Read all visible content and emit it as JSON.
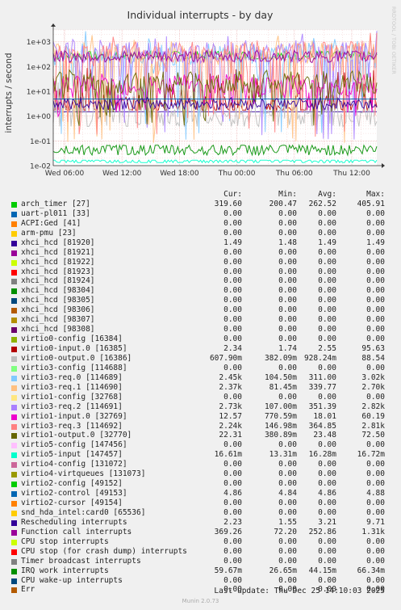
{
  "chart_data": {
    "type": "line",
    "title": "Individual interrupts - by day",
    "ylabel": "interrupts / second",
    "yscale": "log",
    "ylim": [
      0.01,
      3000
    ],
    "yticks": [
      "1e-02",
      "1e-01",
      "1e+00",
      "1e+01",
      "1e+02",
      "1e+03"
    ],
    "xticks": [
      "Wed 06:00",
      "Wed 12:00",
      "Wed 18:00",
      "Thu 00:00",
      "Thu 06:00",
      "Thu 12:00"
    ],
    "side_label": "RRDTOOL / TOBI OETIKER",
    "columns": [
      "Cur:",
      "Min:",
      "Avg:",
      "Max:"
    ],
    "series": [
      {
        "name": "arch_timer [27]",
        "color": "#00cc00",
        "cur": "319.60",
        "min": "200.47",
        "avg": "262.52",
        "max": "405.91"
      },
      {
        "name": "uart-pl011 [33]",
        "color": "#0066b3",
        "cur": "0.00",
        "min": "0.00",
        "avg": "0.00",
        "max": "0.00"
      },
      {
        "name": "ACPI:Ged [41]",
        "color": "#ff8000",
        "cur": "0.00",
        "min": "0.00",
        "avg": "0.00",
        "max": "0.00"
      },
      {
        "name": "arm-pmu [23]",
        "color": "#ffcc00",
        "cur": "0.00",
        "min": "0.00",
        "avg": "0.00",
        "max": "0.00"
      },
      {
        "name": "xhci_hcd [81920]",
        "color": "#330099",
        "cur": "1.49",
        "min": "1.48",
        "avg": "1.49",
        "max": "1.49"
      },
      {
        "name": "xhci_hcd [81921]",
        "color": "#990099",
        "cur": "0.00",
        "min": "0.00",
        "avg": "0.00",
        "max": "0.00"
      },
      {
        "name": "xhci_hcd [81922]",
        "color": "#ccff00",
        "cur": "0.00",
        "min": "0.00",
        "avg": "0.00",
        "max": "0.00"
      },
      {
        "name": "xhci_hcd [81923]",
        "color": "#ff0000",
        "cur": "0.00",
        "min": "0.00",
        "avg": "0.00",
        "max": "0.00"
      },
      {
        "name": "xhci_hcd [81924]",
        "color": "#808080",
        "cur": "0.00",
        "min": "0.00",
        "avg": "0.00",
        "max": "0.00"
      },
      {
        "name": "xhci_hcd [98304]",
        "color": "#008f00",
        "cur": "0.00",
        "min": "0.00",
        "avg": "0.00",
        "max": "0.00"
      },
      {
        "name": "xhci_hcd [98305]",
        "color": "#00487d",
        "cur": "0.00",
        "min": "0.00",
        "avg": "0.00",
        "max": "0.00"
      },
      {
        "name": "xhci_hcd [98306]",
        "color": "#b35a00",
        "cur": "0.00",
        "min": "0.00",
        "avg": "0.00",
        "max": "0.00"
      },
      {
        "name": "xhci_hcd [98307]",
        "color": "#b38f00",
        "cur": "0.00",
        "min": "0.00",
        "avg": "0.00",
        "max": "0.00"
      },
      {
        "name": "xhci_hcd [98308]",
        "color": "#6b006b",
        "cur": "0.00",
        "min": "0.00",
        "avg": "0.00",
        "max": "0.00"
      },
      {
        "name": "virtio0-config [16384]",
        "color": "#8fb300",
        "cur": "0.00",
        "min": "0.00",
        "avg": "0.00",
        "max": "0.00"
      },
      {
        "name": "virtio0-input.0 [16385]",
        "color": "#b30000",
        "cur": "2.34",
        "min": "1.74",
        "avg": "2.55",
        "max": "95.63"
      },
      {
        "name": "virtio0-output.0 [16386]",
        "color": "#bebebe",
        "cur": "607.90m",
        "min": "382.09m",
        "avg": "928.24m",
        "max": "88.54"
      },
      {
        "name": "virtio3-config [114688]",
        "color": "#80ff80",
        "cur": "0.00",
        "min": "0.00",
        "avg": "0.00",
        "max": "0.00"
      },
      {
        "name": "virtio3-req.0 [114689]",
        "color": "#80c9ff",
        "cur": "2.45k",
        "min": "104.50m",
        "avg": "311.00",
        "max": "3.02k"
      },
      {
        "name": "virtio3-req.1 [114690]",
        "color": "#ffc080",
        "cur": "2.37k",
        "min": "81.45m",
        "avg": "339.77",
        "max": "2.70k"
      },
      {
        "name": "virtio1-config [32768]",
        "color": "#ffe680",
        "cur": "0.00",
        "min": "0.00",
        "avg": "0.00",
        "max": "0.00"
      },
      {
        "name": "virtio3-req.2 [114691]",
        "color": "#aa80ff",
        "cur": "2.73k",
        "min": "107.00m",
        "avg": "351.39",
        "max": "2.82k"
      },
      {
        "name": "virtio1-input.0 [32769]",
        "color": "#ee00cc",
        "cur": "12.57",
        "min": "770.59m",
        "avg": "18.01",
        "max": "60.19"
      },
      {
        "name": "virtio3-req.3 [114692]",
        "color": "#ff8080",
        "cur": "2.24k",
        "min": "146.98m",
        "avg": "364.85",
        "max": "2.81k"
      },
      {
        "name": "virtio1-output.0 [32770]",
        "color": "#666600",
        "cur": "22.31",
        "min": "380.89m",
        "avg": "23.48",
        "max": "72.50"
      },
      {
        "name": "virtio5-config [147456]",
        "color": "#ffbfff",
        "cur": "0.00",
        "min": "0.00",
        "avg": "0.00",
        "max": "0.00"
      },
      {
        "name": "virtio5-input [147457]",
        "color": "#00ffcc",
        "cur": "16.61m",
        "min": "13.31m",
        "avg": "16.28m",
        "max": "16.72m"
      },
      {
        "name": "virtio4-config [131072]",
        "color": "#cc6699",
        "cur": "0.00",
        "min": "0.00",
        "avg": "0.00",
        "max": "0.00"
      },
      {
        "name": "virtio4-virtqueues [131073]",
        "color": "#999900",
        "cur": "0.00",
        "min": "0.00",
        "avg": "0.00",
        "max": "0.00"
      },
      {
        "name": "virtio2-config [49152]",
        "color": "#00cc00",
        "cur": "0.00",
        "min": "0.00",
        "avg": "0.00",
        "max": "0.00"
      },
      {
        "name": "virtio2-control [49153]",
        "color": "#0066b3",
        "cur": "4.86",
        "min": "4.84",
        "avg": "4.86",
        "max": "4.88"
      },
      {
        "name": "virtio2-cursor [49154]",
        "color": "#ff8000",
        "cur": "0.00",
        "min": "0.00",
        "avg": "0.00",
        "max": "0.00"
      },
      {
        "name": "snd_hda_intel:card0 [65536]",
        "color": "#ffcc00",
        "cur": "0.00",
        "min": "0.00",
        "avg": "0.00",
        "max": "0.00"
      },
      {
        "name": "Rescheduling interrupts",
        "color": "#330099",
        "cur": "2.23",
        "min": "1.55",
        "avg": "3.21",
        "max": "9.71"
      },
      {
        "name": "Function call interrupts",
        "color": "#990099",
        "cur": "369.26",
        "min": "72.20",
        "avg": "252.86",
        "max": "1.31k"
      },
      {
        "name": "CPU stop interrupts",
        "color": "#ccff00",
        "cur": "0.00",
        "min": "0.00",
        "avg": "0.00",
        "max": "0.00"
      },
      {
        "name": "CPU stop (for crash dump) interrupts",
        "color": "#ff0000",
        "cur": "0.00",
        "min": "0.00",
        "avg": "0.00",
        "max": "0.00"
      },
      {
        "name": "Timer broadcast interrupts",
        "color": "#808080",
        "cur": "0.00",
        "min": "0.00",
        "avg": "0.00",
        "max": "0.00"
      },
      {
        "name": "IRQ work interrupts",
        "color": "#008f00",
        "cur": "59.67m",
        "min": "26.65m",
        "avg": "44.15m",
        "max": "66.34m"
      },
      {
        "name": "CPU wake-up interrupts",
        "color": "#00487d",
        "cur": "0.00",
        "min": "0.00",
        "avg": "0.00",
        "max": "0.00"
      },
      {
        "name": "Err",
        "color": "#b35a00",
        "cur": "0.00",
        "min": "0.00",
        "avg": "0.00",
        "max": "0.00"
      }
    ]
  },
  "footer": {
    "last_update": "Last update: Thu Dec 25 14:10:03 2025",
    "munin": "Munin 2.0.73"
  }
}
